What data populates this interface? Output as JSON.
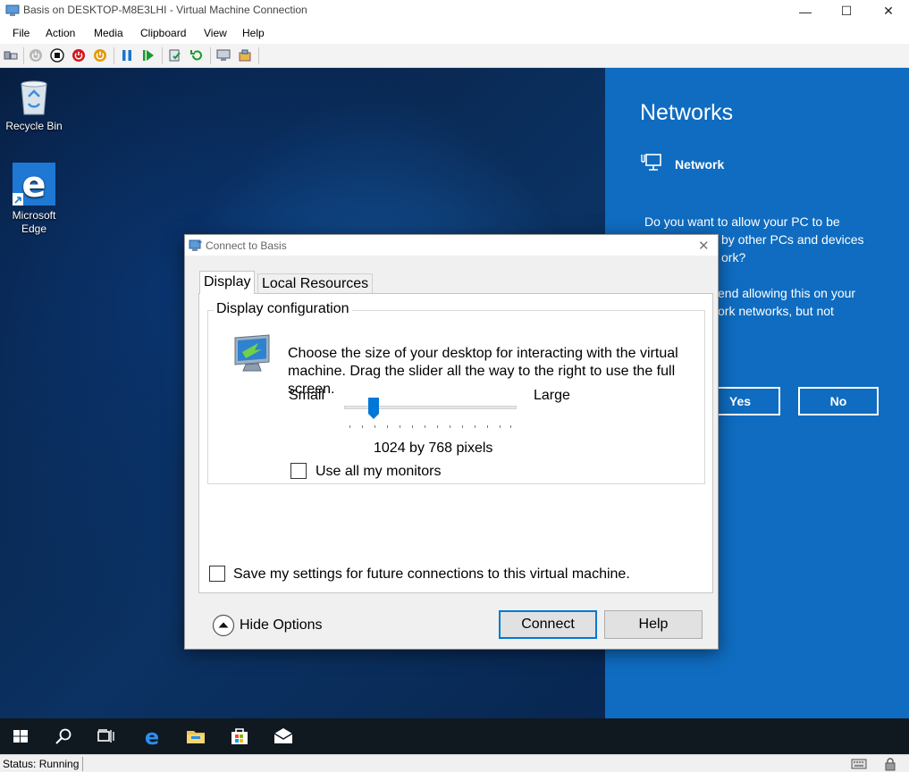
{
  "window": {
    "title": "Basis on DESKTOP-M8E3LHI - Virtual Machine Connection",
    "controls": {
      "minimize": "—",
      "maximize": "☐",
      "close": "✕"
    }
  },
  "menu": [
    "File",
    "Action",
    "Media",
    "Clipboard",
    "View",
    "Help"
  ],
  "toolbar": {
    "icons": [
      "ctrl-alt-del-icon",
      "start-icon",
      "turn-off-icon",
      "shut-down-icon",
      "save-state-icon",
      "pause-icon",
      "resume-icon",
      "checkpoint-icon",
      "revert-icon",
      "enhanced-session-icon",
      "share-icon"
    ]
  },
  "desktop": {
    "icons": [
      {
        "name": "recycle-bin",
        "label": "Recycle Bin"
      },
      {
        "name": "microsoft-edge",
        "label": "Microsoft Edge"
      }
    ]
  },
  "network_flyout": {
    "title": "Networks",
    "network_name": "Network",
    "message": "Do you want to allow your PC to be discoverable by other PCs and devices on this network? We recommend allowing this on your home and work networks, but not public ones.",
    "visible_lines": [
      "Do you want to allow your PC to be",
      "by other PCs and devices",
      "ork?",
      "end allowing this on your",
      "ork networks, but not"
    ],
    "yes_label": "Yes",
    "no_label": "No",
    "accent_color": "#0f6cc0"
  },
  "taskbar": {
    "icons": [
      "start-icon",
      "search-icon",
      "task-view-icon",
      "edge-icon",
      "file-explorer-icon",
      "store-icon",
      "mail-icon"
    ]
  },
  "statusbar": {
    "status": "Status: Running"
  },
  "dialog": {
    "title": "Connect to Basis",
    "close": "✕",
    "tabs": {
      "display": "Display",
      "local_resources": "Local Resources"
    },
    "group_label": "Display configuration",
    "description": "Choose the size of your desktop for interacting with the virtual machine. Drag the slider all the way to the right to use the full screen.",
    "slider": {
      "min_label": "Small",
      "max_label": "Large",
      "position_fraction": 0.17
    },
    "resolution": "1024 by 768 pixels",
    "use_all_monitors": {
      "label": "Use all my monitors",
      "checked": false
    },
    "save_settings": {
      "label": "Save my settings for future connections to this virtual machine.",
      "checked": false
    },
    "hide_options": "Hide Options",
    "connect": "Connect",
    "help": "Help"
  }
}
